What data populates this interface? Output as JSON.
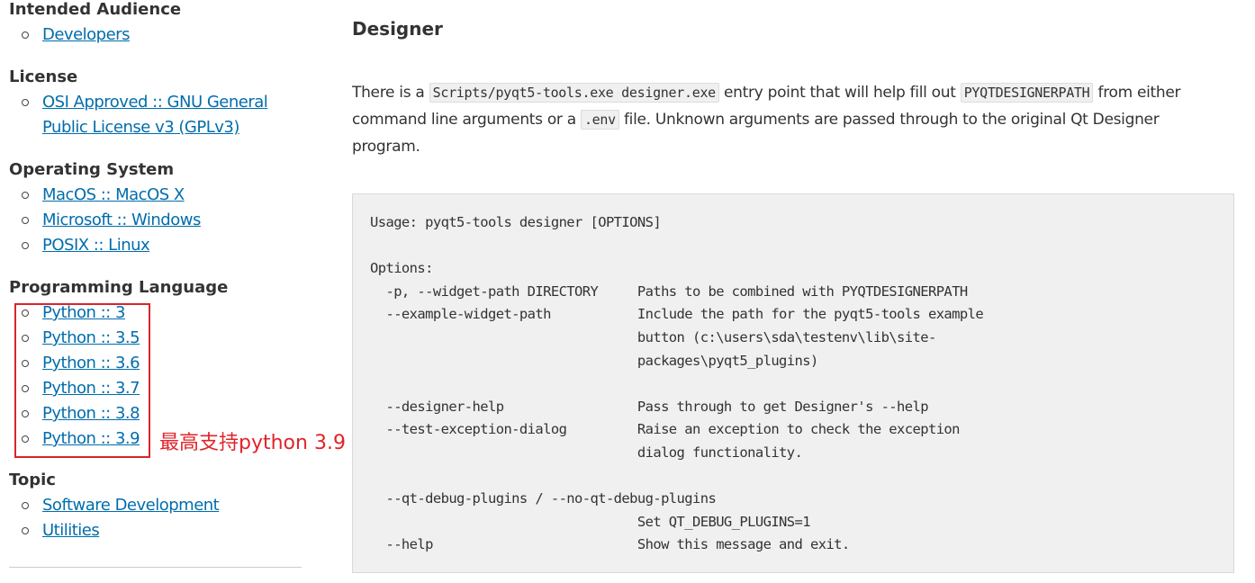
{
  "sidebar": {
    "sections": [
      {
        "title": "Intended Audience",
        "items": [
          [
            "Developers"
          ]
        ]
      },
      {
        "title": "License",
        "items": [
          [
            "OSI Approved :: GNU General",
            "Public License v3 (GPLv3)"
          ]
        ]
      },
      {
        "title": "Operating System",
        "items": [
          [
            "MacOS :: MacOS X"
          ],
          [
            "Microsoft :: Windows"
          ],
          [
            "POSIX :: Linux"
          ]
        ]
      },
      {
        "title": "Programming Language",
        "items": [
          [
            "Python :: 3"
          ],
          [
            "Python :: 3.5"
          ],
          [
            "Python :: 3.6"
          ],
          [
            "Python :: 3.7"
          ],
          [
            "Python :: 3.8"
          ],
          [
            "Python :: 3.9"
          ]
        ]
      },
      {
        "title": "Topic",
        "items": [
          [
            "Software Development"
          ],
          [
            "Utilities"
          ]
        ]
      }
    ]
  },
  "annotation": {
    "text": "最高支持python 3.9",
    "color": "#e0242b"
  },
  "main": {
    "heading": "Designer",
    "paragraph": {
      "t1": "There is a ",
      "code1": "Scripts/pyqt5-tools.exe designer.exe",
      "t2": " entry point that will help fill out ",
      "code2": "PYQTDESIGNERPATH",
      "t3": " from either command line arguments or a ",
      "code3": ".env",
      "t4": " file. Unknown arguments are passed through to the original Qt Designer program."
    },
    "usage_block": "Usage: pyqt5-tools designer [OPTIONS]\n\nOptions:\n  -p, --widget-path DIRECTORY     Paths to be combined with PYQTDESIGNERPATH\n  --example-widget-path           Include the path for the pyqt5-tools example\n                                  button (c:\\users\\sda\\testenv\\lib\\site-\n                                  packages\\pyqt5_plugins)\n\n  --designer-help                 Pass through to get Designer's --help\n  --test-exception-dialog         Raise an exception to check the exception\n                                  dialog functionality.\n\n  --qt-debug-plugins / --no-qt-debug-plugins\n                                  Set QT_DEBUG_PLUGINS=1\n  --help                          Show this message and exit."
  },
  "colors": {
    "link": "#006dad",
    "highlight_border": "#d9252a",
    "code_background": "#f0f0f0"
  }
}
